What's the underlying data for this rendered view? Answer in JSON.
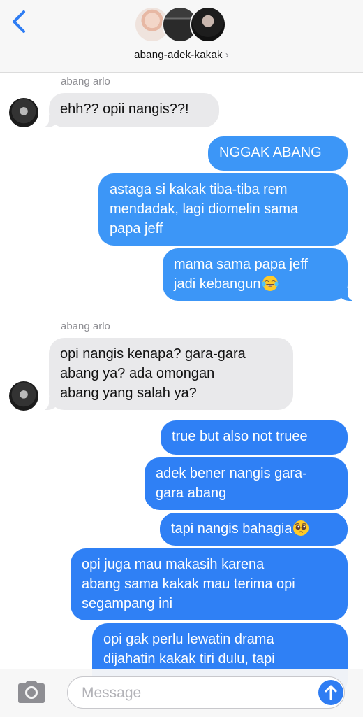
{
  "header": {
    "back_icon": "chevron-left-icon",
    "group_name": "abang-adek-kakak",
    "accent": "#2f7df3"
  },
  "messages": [
    {
      "sender": "abang arlo",
      "direction": "in",
      "lines": [
        "ehh?? opii nangis??!"
      ]
    },
    {
      "direction": "out",
      "lines": [
        "NGGAK ABANG"
      ]
    },
    {
      "direction": "out",
      "lines": [
        "astaga si kakak tiba-tiba rem",
        "mendadak, lagi diomelin sama",
        "papa jeff"
      ]
    },
    {
      "direction": "out",
      "lines": [
        "mama sama papa jeff",
        "jadi kebangun"
      ],
      "emoji": "tears-of-joy-emoji"
    },
    {
      "sender": "abang arlo",
      "direction": "in",
      "lines": [
        "opi nangis kenapa? gara-gara",
        "abang ya? ada omongan",
        "abang yang salah ya?"
      ]
    },
    {
      "direction": "out",
      "lines": [
        "true but also not truee"
      ]
    },
    {
      "direction": "out",
      "lines": [
        "adek bener nangis gara-",
        "gara abang"
      ]
    },
    {
      "direction": "out",
      "lines": [
        "tapi nangis bahagia"
      ],
      "emoji": "pleading-face-emoji"
    },
    {
      "direction": "out",
      "lines": [
        "opi juga mau makasih karena",
        "abang sama kakak mau terima opi",
        "segampang ini"
      ]
    },
    {
      "direction": "out",
      "lines": [
        "opi gak perlu lewatin drama",
        "dijahatin kakak tiri dulu, tapi"
      ]
    }
  ],
  "input": {
    "placeholder": "Message",
    "camera_icon": "camera-icon",
    "send_icon": "arrow-up-icon"
  }
}
